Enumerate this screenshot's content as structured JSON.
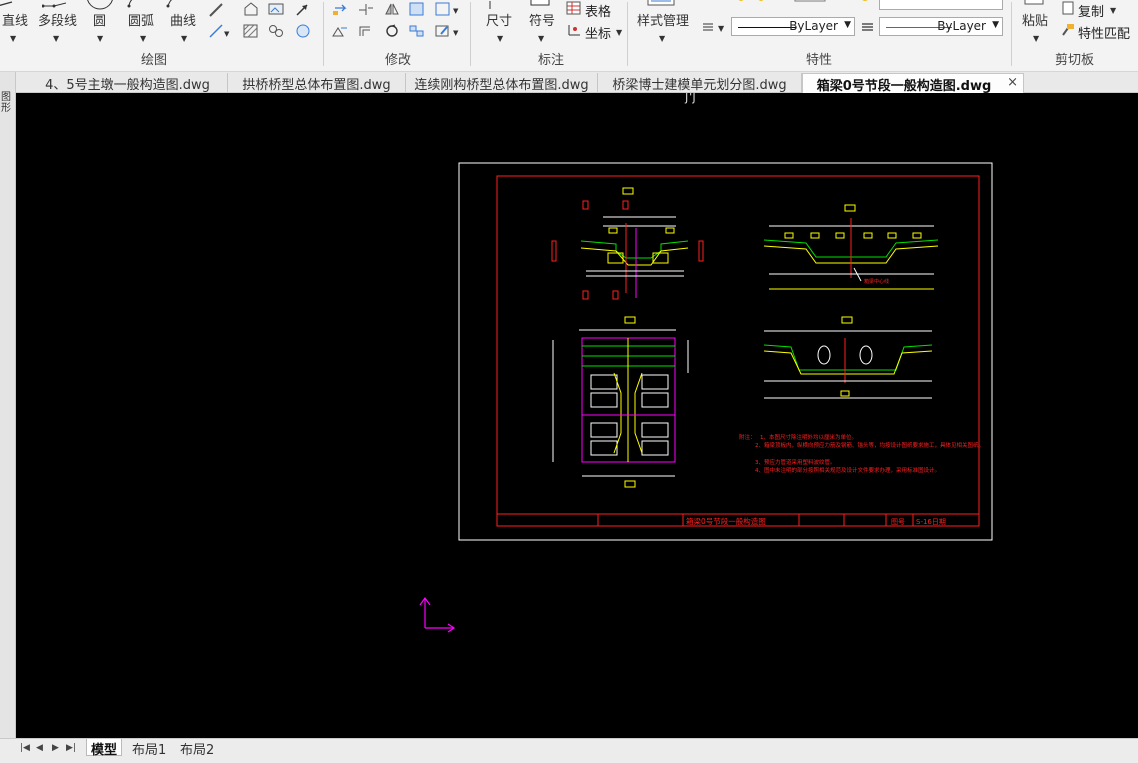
{
  "ribbon": {
    "draw_group": {
      "label": "绘图",
      "tools": [
        "直线",
        "多段线",
        "圆",
        "圆弧",
        "曲线"
      ]
    },
    "modify_group": {
      "label": "修改"
    },
    "annotate_group": {
      "label": "标注",
      "tools": [
        "尺寸",
        "符号"
      ],
      "table": "表格",
      "coords": "坐标"
    },
    "properties_group": {
      "label": "特性",
      "style_manager": "样式管理",
      "linetype_value": "ByLayer",
      "lineweight_value": "ByLayer",
      "color_value": "ByLayer"
    },
    "clipboard_group": {
      "label": "剪切板",
      "paste": "粘贴",
      "copy": "复制",
      "match_props": "特性匹配"
    }
  },
  "tabs": [
    {
      "label": "4、5号主墩一般构造图.dwg",
      "active": false
    },
    {
      "label": "拱桥桥型总体布置图.dwg",
      "active": false
    },
    {
      "label": "连续刚构桥型总体布置图.dwg",
      "active": false
    },
    {
      "label": "桥梁博士建模单元划分图.dwg",
      "active": false
    },
    {
      "label": "箱梁0号节段一般构造图.dwg",
      "active": true
    }
  ],
  "tab_close": "×",
  "left_strip_label": "图形",
  "canvas_top_fragment": "ʃ'ʃ",
  "drawing": {
    "title_block_text": "箱梁0号节段一般构造图",
    "sheet_no_label": "图号",
    "sheet_no": "S-16日期",
    "notes_header": "附注：",
    "notes": [
      "1、本图尺寸除注明外均以厘米为单位。",
      "2、箱梁顶板内，纵横向预应力筋及钢筋、锚头等，均按设计图纸要求施工，具体见相关图纸。",
      "3、预应力管道采用塑料波纹管。",
      "4、图中未注明的部分按照相关规范及设计文件要求办理，采用标准图设计。"
    ],
    "center_line_label": "箱梁中心线"
  },
  "layout_tabs": [
    {
      "label": "模型",
      "active": true
    },
    {
      "label": "布局1",
      "active": false
    },
    {
      "label": "布局2",
      "active": false
    }
  ],
  "colors": {
    "canvas_bg": "#000000",
    "drawing_red": "#ff2020",
    "drawing_yellow": "#ffff00",
    "drawing_green": "#00e000",
    "drawing_magenta": "#ff00ff",
    "ucs": "#ff00ff"
  }
}
